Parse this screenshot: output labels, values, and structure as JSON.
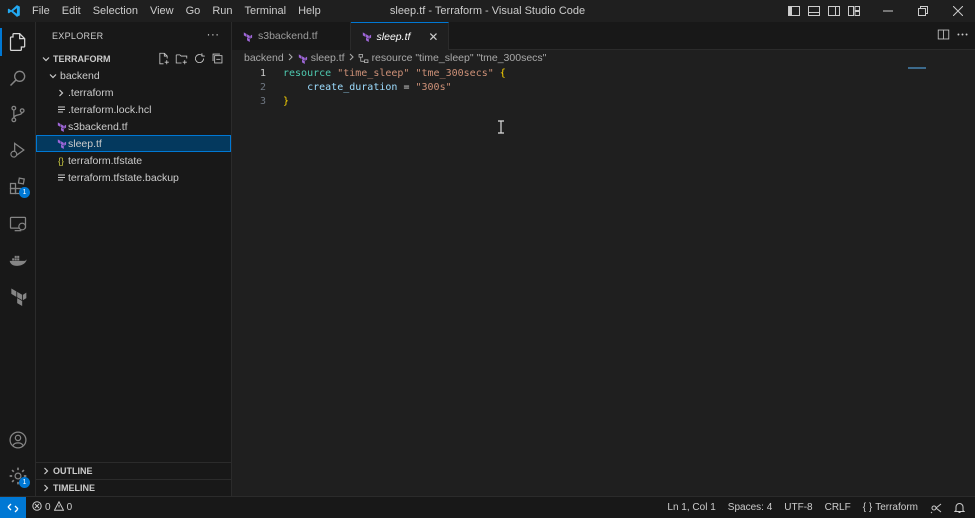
{
  "window": {
    "title": "sleep.tf - Terraform - Visual Studio Code",
    "menu": [
      "File",
      "Edit",
      "Selection",
      "View",
      "Go",
      "Run",
      "Terminal",
      "Help"
    ]
  },
  "activity_bar": {
    "extensions_badge": "1",
    "manage_badge": "1"
  },
  "sidebar": {
    "header": "EXPLORER",
    "more": "···",
    "workspace": "TERRAFORM",
    "folder": "backend",
    "items": [
      {
        "label": ".terraform",
        "icon": "chevron-right-icon"
      },
      {
        "label": ".terraform.lock.hcl",
        "icon": "lines-icon"
      },
      {
        "label": "s3backend.tf",
        "icon": "terraform-icon"
      },
      {
        "label": "sleep.tf",
        "icon": "terraform-icon"
      },
      {
        "label": "terraform.tfstate",
        "icon": "json-braces-icon"
      },
      {
        "label": "terraform.tfstate.backup",
        "icon": "lines-icon"
      }
    ],
    "json_icon_glyph": "{}",
    "outline": "OUTLINE",
    "timeline": "TIMELINE"
  },
  "tabs": [
    {
      "label": "s3backend.tf",
      "active": false
    },
    {
      "label": "sleep.tf",
      "active": true,
      "close": "✕"
    }
  ],
  "breadcrumb": {
    "folder": "backend",
    "file": "sleep.tf",
    "symbol": "resource \"time_sleep\" \"tme_300secs\""
  },
  "code": {
    "line_numbers": [
      "1",
      "2",
      "3"
    ],
    "line1": {
      "kw": "resource",
      "s1": "\"time_sleep\"",
      "s2": "\"tme_300secs\"",
      "brace": "{"
    },
    "line2": {
      "attr": "create_duration",
      "op": "=",
      "val": "\"300s\""
    },
    "line3": {
      "brace": "}"
    }
  },
  "status": {
    "errors": "0",
    "warnings": "0",
    "position": "Ln 1, Col 1",
    "spaces": "Spaces: 4",
    "encoding": "UTF-8",
    "eol": "CRLF",
    "language": "Terraform",
    "language_glyph": "{ }"
  },
  "colors": {
    "accent": "#0078d4",
    "terraform": "#a067da",
    "keyword": "#4ec9b0",
    "string": "#ce9178",
    "brace": "#ffd700"
  }
}
